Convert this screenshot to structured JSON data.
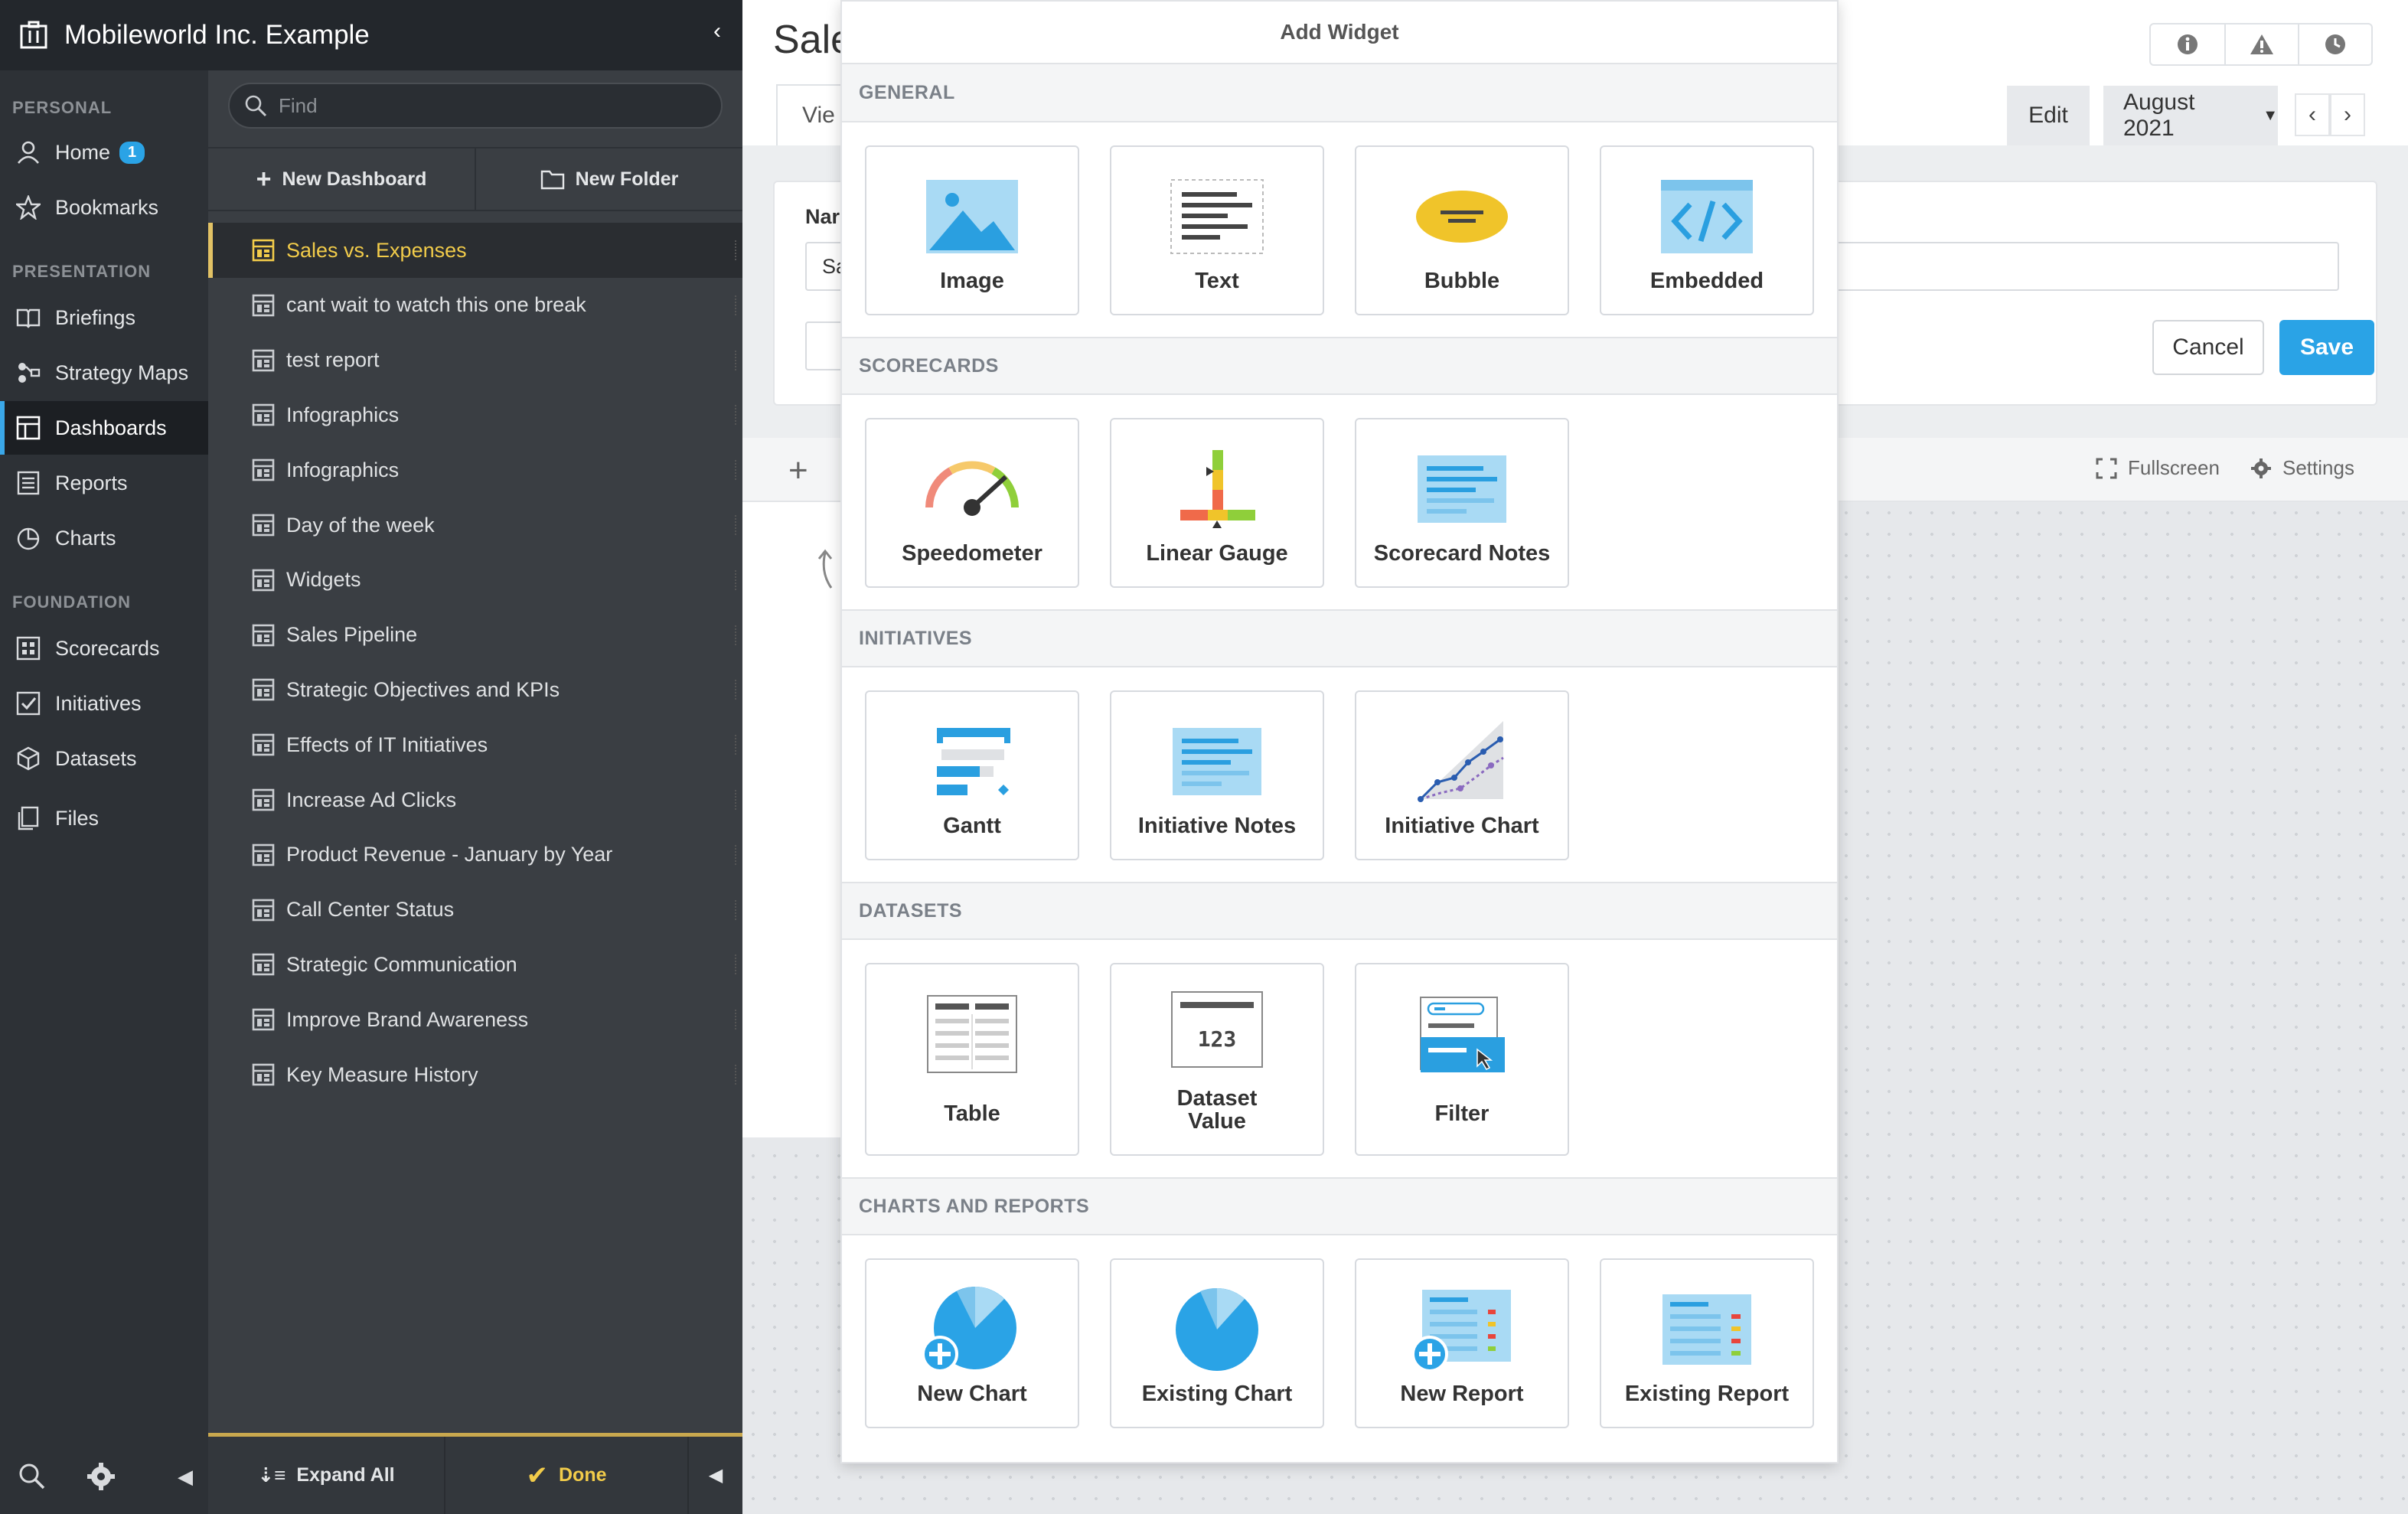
{
  "app": {
    "org_title": "Mobileworld Inc. Example"
  },
  "leftnav": {
    "sections": [
      {
        "label": "PERSONAL",
        "items": [
          {
            "label": "Home",
            "badge": "1"
          },
          {
            "label": "Bookmarks"
          }
        ]
      },
      {
        "label": "PRESENTATION",
        "items": [
          {
            "label": "Briefings"
          },
          {
            "label": "Strategy Maps"
          },
          {
            "label": "Dashboards",
            "active": true
          },
          {
            "label": "Reports"
          },
          {
            "label": "Charts"
          }
        ]
      },
      {
        "label": "FOUNDATION",
        "items": [
          {
            "label": "Scorecards"
          },
          {
            "label": "Initiatives"
          },
          {
            "label": "Datasets"
          },
          {
            "label": "Files"
          }
        ]
      }
    ]
  },
  "dash_panel": {
    "find_placeholder": "Find",
    "new_dashboard": "New Dashboard",
    "new_folder": "New Folder",
    "items": [
      "Sales vs. Expenses",
      "cant wait to watch this one break",
      "test report",
      "Infographics",
      "Infographics",
      "Day of the week",
      "Widgets",
      "Sales Pipeline",
      "Strategic Objectives and KPIs",
      "Effects of IT Initiatives",
      "Increase Ad Clicks",
      "Product Revenue - January by Year",
      "Call Center Status",
      "Strategic Communication",
      "Improve Brand Awareness",
      "Key Measure History"
    ],
    "expand_all": "Expand All",
    "done": "Done"
  },
  "main": {
    "title_partial": "Sale",
    "view_tab_partial": "Vie",
    "edit_tab": "Edit",
    "period": "August 2021",
    "name_label_partial": "Nar",
    "name_value_partial": "Sa",
    "cancel": "Cancel",
    "save": "Save",
    "fullscreen": "Fullscreen",
    "settings": "Settings"
  },
  "modal": {
    "title": "Add Widget",
    "sections": [
      {
        "label": "GENERAL",
        "tiles": [
          "Image",
          "Text",
          "Bubble",
          "Embedded"
        ]
      },
      {
        "label": "SCORECARDS",
        "tiles": [
          "Speedometer",
          "Linear Gauge",
          "Scorecard Notes"
        ]
      },
      {
        "label": "INITIATIVES",
        "tiles": [
          "Gantt",
          "Initiative Notes",
          "Initiative Chart"
        ]
      },
      {
        "label": "DATASETS",
        "tiles": [
          "Table",
          "Dataset Value",
          "Filter"
        ]
      },
      {
        "label": "CHARTS AND REPORTS",
        "tiles": [
          "New Chart",
          "Existing Chart",
          "New Report",
          "Existing Report"
        ]
      }
    ],
    "dataset_value_sample": "123"
  },
  "colors": {
    "accent": "#2aa3e6",
    "active_dashboard": "#f2cc4a",
    "bubble": "#f0c42a"
  }
}
